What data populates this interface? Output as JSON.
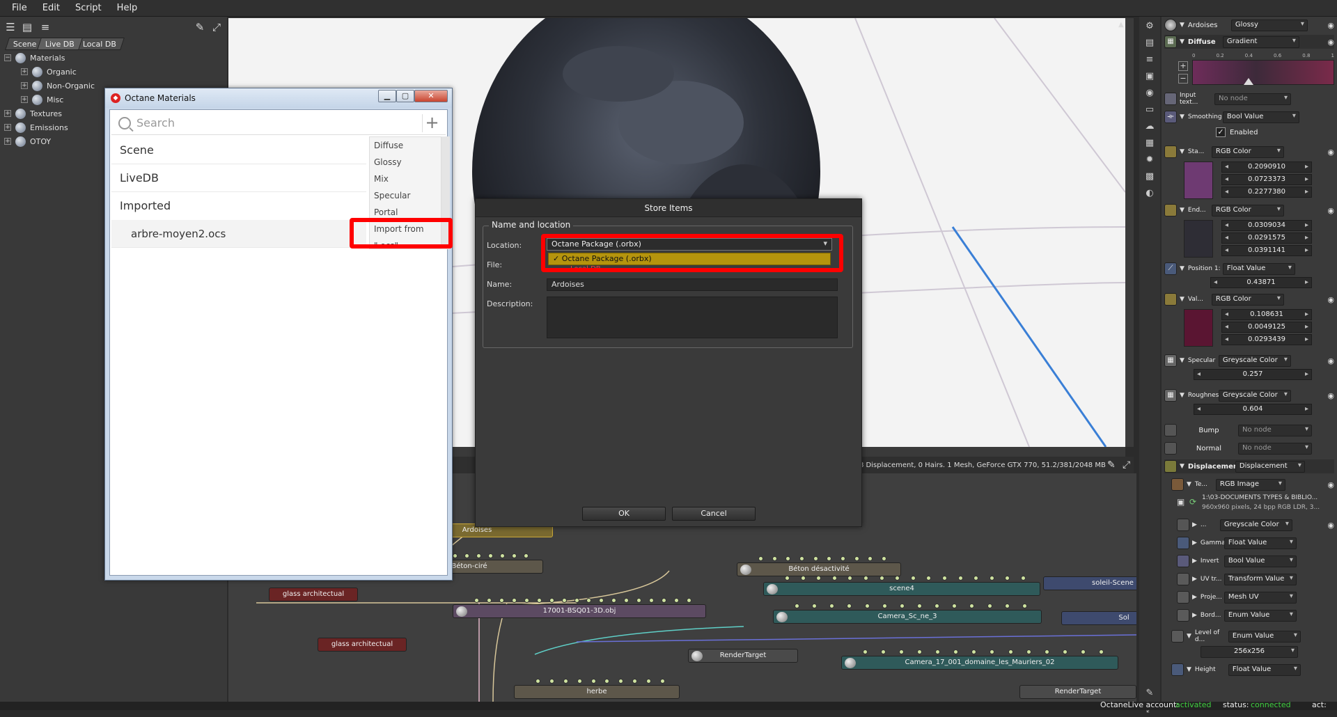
{
  "menubar": {
    "items": [
      "File",
      "Edit",
      "Script",
      "Help"
    ]
  },
  "left_panel": {
    "tabs": [
      "Scene",
      "Live DB",
      "Local DB"
    ],
    "tree": [
      {
        "label": "Materials",
        "indent": 0
      },
      {
        "label": "Organic",
        "indent": 1
      },
      {
        "label": "Non-Organic",
        "indent": 1
      },
      {
        "label": "Misc",
        "indent": 1
      },
      {
        "label": "Textures",
        "indent": 0
      },
      {
        "label": "Emissions",
        "indent": 0
      },
      {
        "label": "OTOY",
        "indent": 0
      }
    ]
  },
  "viewport": {
    "status_text": "8 Displacement, 0 Hairs. 1 Mesh, GeForce GTX 770, 51.2/381/2048 MB"
  },
  "node_graph": {
    "nodes": [
      "Ardoises",
      "Béton-ciré",
      "Béton désactivité",
      "glass architectual",
      "17001-BSQ01-3D.obj",
      "scene4",
      "soleil-Scene",
      "Camera_Sc_ne_3",
      "Sol",
      "glass architectual",
      "RenderTarget",
      "Camera_17_001_domaine_les_Mauriers_02",
      "herbe",
      "RenderTarget"
    ]
  },
  "octane_materials_window": {
    "title": "Octane Materials",
    "search_placeholder": "Search",
    "add_label": "+",
    "categories": [
      "Scene",
      "LiveDB",
      "Imported"
    ],
    "imported_item": "arbre-moyen2.ocs",
    "context_menu": [
      "Diffuse",
      "Glossy",
      "Mix",
      "Specular",
      "Portal",
      "Import from \".ocs\""
    ]
  },
  "store_dialog": {
    "title": "Store Items",
    "group_label": "Name and location",
    "location_label": "Location:",
    "location_value": "Octane Package (.orbx)",
    "location_option": "✓  Octane Package (.orbx)",
    "location_option_ghost": "Local DB",
    "file_label": "File:",
    "name_label": "Name:",
    "name_value": "Ardoises",
    "description_label": "Description:",
    "ok_label": "OK",
    "cancel_label": "Cancel"
  },
  "right_panel": {
    "header_name": "Ardoises",
    "header_type": "Glossy",
    "diffuse_label": "Diffuse",
    "diffuse_type": "Gradient",
    "gradient_ticks": [
      "0",
      "0.2",
      "0.4",
      "0.6",
      "0.8",
      "1"
    ],
    "input_text_label": "Input text...",
    "input_text_value": "No node",
    "smoothing_label": "Smoothing",
    "smoothing_type": "Bool Value",
    "enabled_label": "Enabled",
    "start_label": "Sta...",
    "start_type": "RGB Color",
    "start_values": [
      "0.2090910",
      "0.0723373",
      "0.2277380"
    ],
    "end_label": "End...",
    "end_type": "RGB Color",
    "end_values": [
      "0.0309034",
      "0.0291575",
      "0.0391141"
    ],
    "position_label": "Position 1:",
    "position_type": "Float Value",
    "position_value": "0.43871",
    "val_label": "Val...",
    "val_type": "RGB Color",
    "val_values": [
      "0.108631",
      "0.0049125",
      "0.0293439"
    ],
    "specular_label": "Specular",
    "specular_type": "Greyscale Color",
    "specular_value": "0.257",
    "roughness_label": "Roughness",
    "roughness_type": "Greyscale Color",
    "roughness_value": "0.604",
    "bump_label": "Bump",
    "bump_value": "No node",
    "normal_label": "Normal",
    "normal_value": "No node",
    "displacement_label": "Displacement",
    "displacement_type": "Displacement",
    "texture_label": "Te...",
    "texture_type": "RGB Image",
    "texture_path": "1:\\03-DOCUMENTS TYPES & BIBLIO...",
    "texture_info": "960x960 pixels, 24 bpp RGB LDR, 3...",
    "sub_rows": [
      {
        "label": "...",
        "type": "Greyscale Color"
      },
      {
        "label": "Gamma",
        "type": "Float Value"
      },
      {
        "label": "Invert",
        "type": "Bool Value"
      },
      {
        "label": "UV tr...",
        "type": "Transform Value"
      },
      {
        "label": "Proje...",
        "type": "Mesh UV"
      },
      {
        "label": "Bord...",
        "type": "Enum Value"
      }
    ],
    "level_label": "Level of d...",
    "level_type": "Enum Value",
    "level_value": "256x256",
    "height_label": "Height",
    "height_type": "Float Value"
  },
  "bottom_bar": {
    "account_label": "OctaneLive account:",
    "account_value": "activated",
    "status_label": "status:",
    "status_value": "connected",
    "act_label": "act:"
  },
  "colors": {
    "highlight_red": "#ff0000",
    "start_swatch": "#6e3a72",
    "end_swatch": "#2e2d35",
    "val_swatch": "#5a1532",
    "option_yellow": "#b5940d",
    "status_green": "#3fd03f"
  }
}
